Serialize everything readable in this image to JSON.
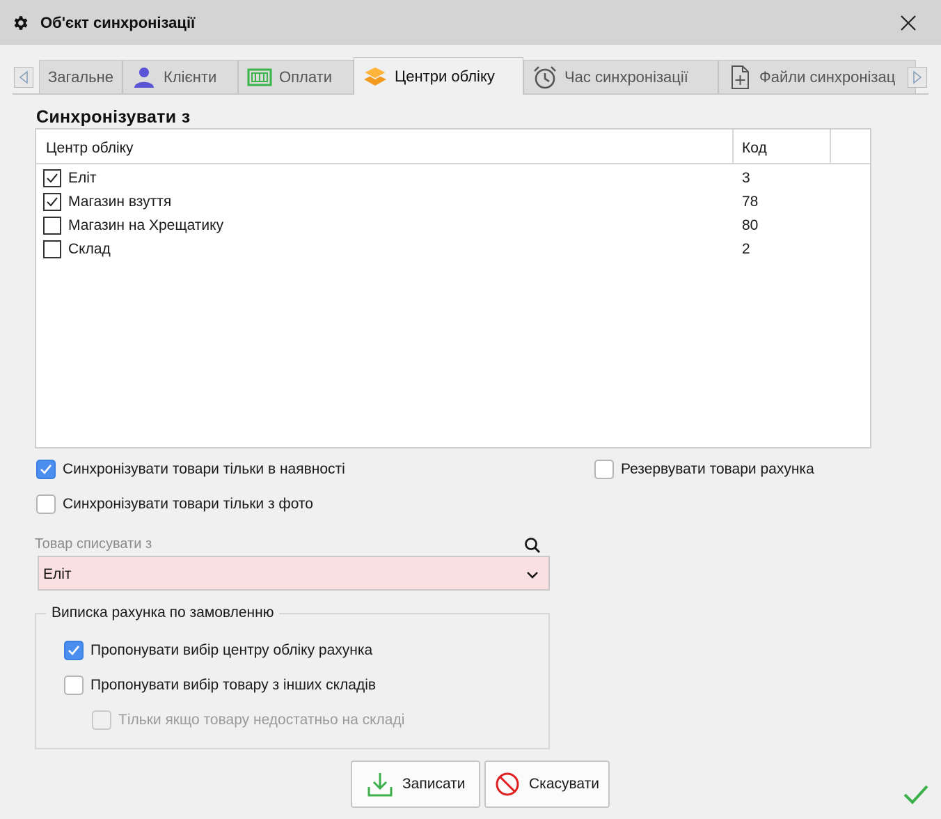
{
  "window": {
    "title": "Об'єкт синхронізації"
  },
  "tabs": [
    {
      "label": "Загальне",
      "icon": "none"
    },
    {
      "label": "Клієнти",
      "icon": "user-icon"
    },
    {
      "label": "Оплати",
      "icon": "cash-icon"
    },
    {
      "label": "Центри обліку",
      "icon": "layers-icon",
      "active": true
    },
    {
      "label": "Час синхронізації",
      "icon": "alarm-clock-icon"
    },
    {
      "label": "Файли синхронізац",
      "icon": "file-add-icon"
    }
  ],
  "section": {
    "title": "Синхронізувати з"
  },
  "grid": {
    "columns": [
      "Центр обліку",
      "Код"
    ],
    "rows": [
      {
        "name": "Еліт",
        "code": "3",
        "checked": true
      },
      {
        "name": "Магазин взуття",
        "code": "78",
        "checked": true
      },
      {
        "name": "Магазин на Хрещатику",
        "code": "80",
        "checked": false
      },
      {
        "name": "Склад",
        "code": "2",
        "checked": false
      }
    ]
  },
  "options": {
    "only_in_stock": {
      "label": "Синхронізувати товари тільки в наявності",
      "checked": true
    },
    "only_with_photo": {
      "label": "Синхронізувати товари тільки з фото",
      "checked": false
    },
    "reserve_invoice": {
      "label": "Резервувати товари рахунка",
      "checked": false
    }
  },
  "write_off": {
    "label": "Товар списувати з",
    "value": "Еліт"
  },
  "invoice_group": {
    "legend": "Виписка рахунка по замовленню",
    "offer_center": {
      "label": "Пропонувати вибір центру обліку рахунка",
      "checked": true
    },
    "offer_other_wh": {
      "label": "Пропонувати вибір товару з інших складів",
      "checked": false
    },
    "only_if_insufficient": {
      "label": "Тільки якщо товару недостатньо на складі",
      "checked": false,
      "disabled": true
    }
  },
  "buttons": {
    "save": "Записати",
    "cancel": "Скасувати"
  },
  "colors": {
    "accent": "#4a8ef0",
    "select_bg": "#fae0e0",
    "save_icon": "#3cb04a",
    "cancel_icon": "#e02020",
    "user_icon": "#5a55d6",
    "cash_icon": "#39b54a",
    "layers_icon": "#f39a1e"
  }
}
